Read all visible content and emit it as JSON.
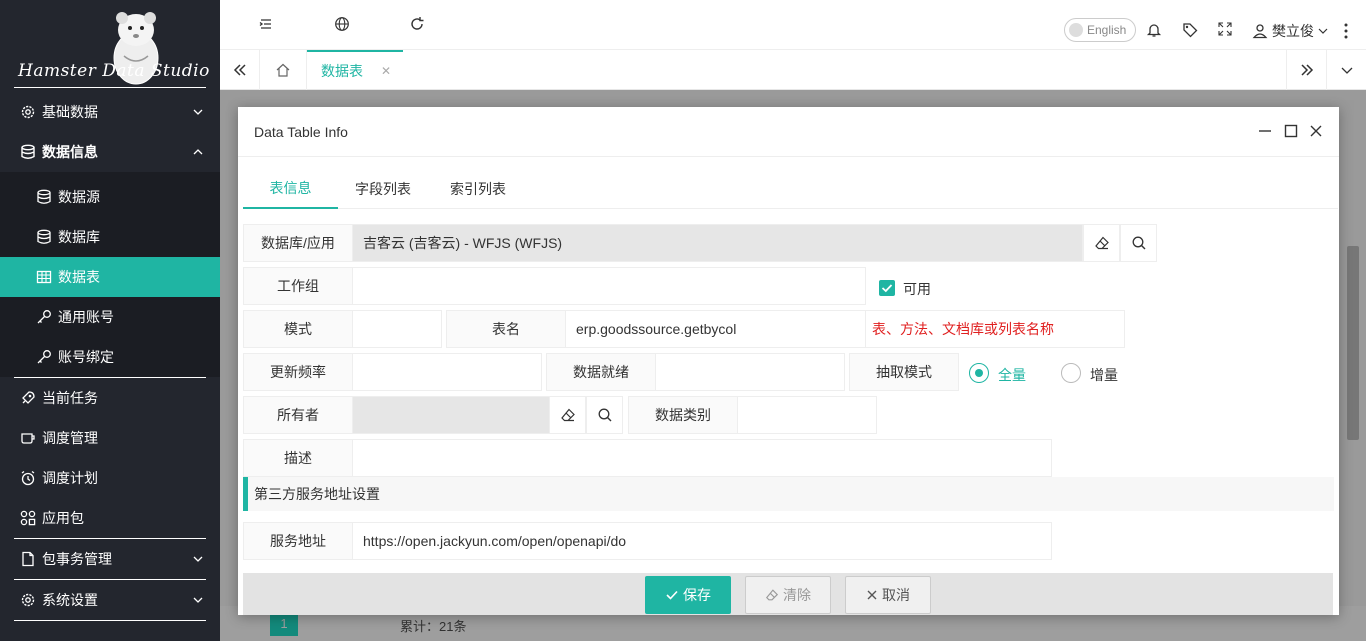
{
  "logo": {
    "text": "Hamster Data   Studio"
  },
  "sidebar": {
    "items": [
      {
        "label": "基础数据",
        "icon": "gear-icon"
      },
      {
        "label": "数据信息",
        "icon": "database-icon"
      },
      {
        "label": "数据源",
        "icon": "database-icon"
      },
      {
        "label": "数据库",
        "icon": "database-icon"
      },
      {
        "label": "数据表",
        "icon": "table-icon"
      },
      {
        "label": "通用账号",
        "icon": "key-icon"
      },
      {
        "label": "账号绑定",
        "icon": "key-icon"
      },
      {
        "label": "当前任务",
        "icon": "rocket-icon"
      },
      {
        "label": "调度管理",
        "icon": "cup-icon"
      },
      {
        "label": "调度计划",
        "icon": "alarm-icon"
      },
      {
        "label": "应用包",
        "icon": "apps-icon"
      },
      {
        "label": "包事务管理",
        "icon": "file-icon"
      },
      {
        "label": "系统设置",
        "icon": "gear-icon"
      }
    ]
  },
  "header": {
    "language": "English",
    "user": "樊立俊"
  },
  "tabs": {
    "active": "数据表"
  },
  "background": {
    "total": "累计：21条",
    "page": "1"
  },
  "dialog": {
    "title": "Data Table Info",
    "tabs": [
      "表信息",
      "字段列表",
      "索引列表"
    ],
    "fields": {
      "db_label": "数据库/应用",
      "db_value": "吉客云 (吉客云) - WFJS (WFJS)",
      "group_label": "工作组",
      "group_value": "",
      "enabled_label": "可用",
      "schema_label": "模式",
      "schema_value": "",
      "table_label": "表名",
      "table_value": "erp.goodssource.getbycol",
      "table_hint": "表、方法、文档库或列表名称",
      "freq_label": "更新频率",
      "freq_value": "",
      "ready_label": "数据就绪",
      "ready_value": "",
      "extract_label": "抽取模式",
      "extract_full": "全量",
      "extract_inc": "增量",
      "owner_label": "所有者",
      "owner_value": "",
      "category_label": "数据类别",
      "category_value": "",
      "desc_label": "描述",
      "desc_value": "",
      "section_title": "第三方服务地址设置",
      "service_label": "服务地址",
      "service_value": "https://open.jackyun.com/open/openapi/do"
    },
    "buttons": {
      "save": "保存",
      "clear": "清除",
      "cancel": "取消"
    }
  }
}
